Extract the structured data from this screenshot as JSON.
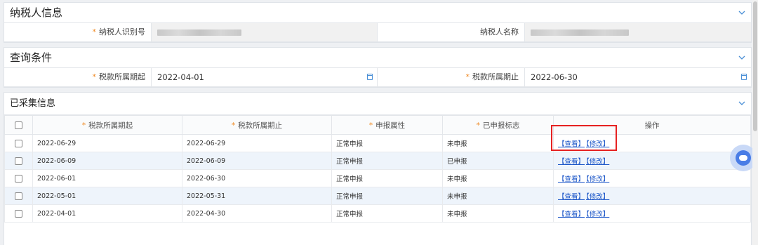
{
  "taxpayer": {
    "title": "纳税人信息",
    "id_label": "纳税人识别号",
    "name_label": "纳税人名称",
    "required_mark": "*"
  },
  "query": {
    "title": "查询条件",
    "start_label": "税款所属期起",
    "start_value": "2022-04-01",
    "end_label": "税款所属期止",
    "end_value": "2022-06-30"
  },
  "collected": {
    "title": "已采集信息",
    "columns": [
      "税款所属期起",
      "税款所属期止",
      "申报属性",
      "已申报标志",
      "操作"
    ],
    "rows": [
      {
        "start": "2022-06-29",
        "end": "2022-06-29",
        "attr": "正常申报",
        "flag": "未申报",
        "view": "【查看】",
        "edit": "【修改】"
      },
      {
        "start": "2022-06-09",
        "end": "2022-06-09",
        "attr": "正常申报",
        "flag": "已申报",
        "view": "【查看】",
        "edit": "【修改】"
      },
      {
        "start": "2022-06-01",
        "end": "2022-06-30",
        "attr": "正常申报",
        "flag": "未申报",
        "view": "【查看】",
        "edit": "【修改】"
      },
      {
        "start": "2022-05-01",
        "end": "2022-05-31",
        "attr": "正常申报",
        "flag": "未申报",
        "view": "【查看】",
        "edit": "【修改】"
      },
      {
        "start": "2022-04-01",
        "end": "2022-04-30",
        "attr": "正常申报",
        "flag": "未申报",
        "view": "【查看】",
        "edit": "【修改】"
      }
    ]
  },
  "colors": {
    "accent": "#4a8fd6",
    "required": "#f08a24",
    "highlight": "#e62222",
    "link": "#1a55c8"
  }
}
